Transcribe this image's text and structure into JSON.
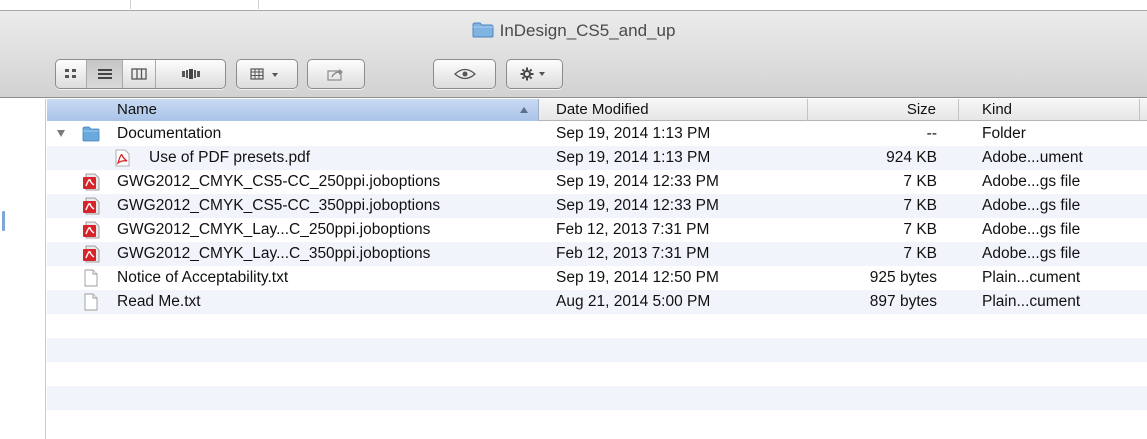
{
  "window": {
    "title": "InDesign_CS5_and_up"
  },
  "toolbar": {
    "view_buttons": [
      "icon-view-icon",
      "list-view-icon",
      "column-view-icon",
      "cover-flow-icon"
    ],
    "arrange_button": "arrange-icon",
    "share_button": "share-icon",
    "quicklook_button": "eye-icon",
    "action_button": "gear-icon"
  },
  "columns": {
    "name": "Name",
    "date": "Date Modified",
    "size": "Size",
    "kind": "Kind"
  },
  "files": [
    {
      "name": "Documentation",
      "date": "Sep 19, 2014 1:13 PM",
      "size": "--",
      "kind": "Folder",
      "icon": "folder-icon",
      "expanded": true,
      "indent": 0
    },
    {
      "name": "Use of PDF presets.pdf",
      "date": "Sep 19, 2014 1:13 PM",
      "size": "924 KB",
      "kind": "Adobe...ument",
      "icon": "pdf-icon",
      "indent": 1
    },
    {
      "name": "GWG2012_CMYK_CS5-CC_250ppi.joboptions",
      "date": "Sep 19, 2014 12:33 PM",
      "size": "7 KB",
      "kind": "Adobe...gs file",
      "icon": "joboptions-icon",
      "indent": 0
    },
    {
      "name": "GWG2012_CMYK_CS5-CC_350ppi.joboptions",
      "date": "Sep 19, 2014 12:33 PM",
      "size": "7 KB",
      "kind": "Adobe...gs file",
      "icon": "joboptions-icon",
      "indent": 0
    },
    {
      "name": "GWG2012_CMYK_Lay...C_250ppi.joboptions",
      "date": "Feb 12, 2013 7:31 PM",
      "size": "7 KB",
      "kind": "Adobe...gs file",
      "icon": "joboptions-icon",
      "indent": 0
    },
    {
      "name": "GWG2012_CMYK_Lay...C_350ppi.joboptions",
      "date": "Feb 12, 2013 7:31 PM",
      "size": "7 KB",
      "kind": "Adobe...gs file",
      "icon": "joboptions-icon",
      "indent": 0
    },
    {
      "name": "Notice of Acceptability.txt",
      "date": "Sep 19, 2014 12:50 PM",
      "size": "925 bytes",
      "kind": "Plain...cument",
      "icon": "text-file-icon",
      "indent": 0
    },
    {
      "name": "Read Me.txt",
      "date": "Aug 21, 2014 5:00 PM",
      "size": "897 bytes",
      "kind": "Plain...cument",
      "icon": "text-file-icon",
      "indent": 0
    }
  ],
  "colors": {
    "selected_header": "#a9c3e8",
    "alt_row": "#f1f5fb",
    "folder": "#6aa9dc",
    "pdf_red": "#d8232a"
  }
}
